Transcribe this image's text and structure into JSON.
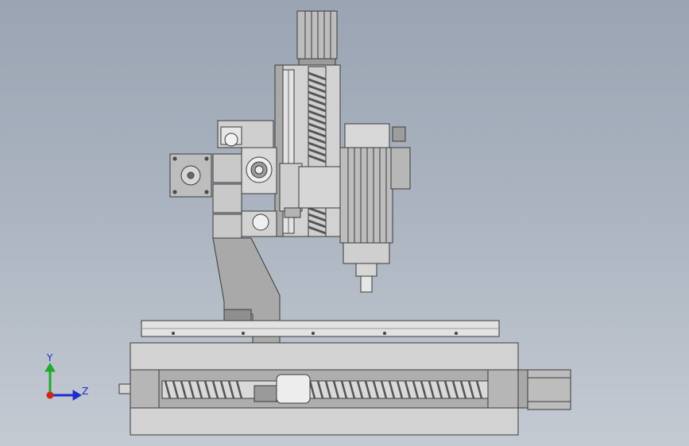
{
  "window": {
    "view": "front",
    "background_colors": [
      "#9aa4b2",
      "#c4cad2"
    ]
  },
  "model": {
    "parts": [
      "z-axis-stepper-motor",
      "z-axis-ball-screw",
      "z-axis-column-plate",
      "spindle-motor",
      "spindle-junction-box",
      "spindle-nose",
      "y-axis-stepper-motor",
      "linear-bearing-blocks",
      "support-bracket",
      "x-axis-linear-rail",
      "x-axis-base-frame",
      "x-axis-ball-screw",
      "x-axis-ball-nut",
      "x-axis-stepper-motor"
    ],
    "colors": {
      "metal_light": "#d9d9d9",
      "metal_mid": "#b9b9b9",
      "metal_dark": "#8e8e8e",
      "edge": "#3a3a3a"
    }
  },
  "triad": {
    "y_label": "Y",
    "z_label": "Z",
    "colors": {
      "y": "#1faa2c",
      "z": "#1d2bd0",
      "origin": "#d0241d"
    }
  }
}
